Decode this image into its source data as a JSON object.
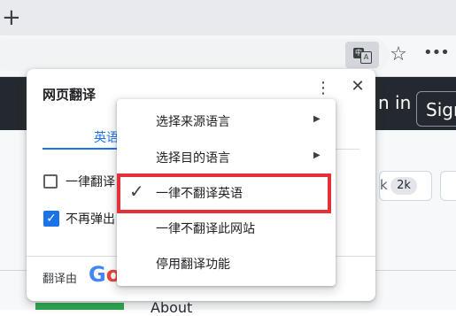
{
  "browser": {
    "new_tab_icon": "plus-icon",
    "translate_icon_glyph_a": "中",
    "translate_icon_glyph_b": "A",
    "favorite_icon": "star-icon",
    "more_icon": "more-horizontal-icon",
    "more_glyph": "•••"
  },
  "website": {
    "signin": "n in",
    "signup": "Sign",
    "badge_prefix": "k",
    "badge_count": "2k",
    "about": "About"
  },
  "translate_panel": {
    "title": "网页翻译",
    "more_glyph": "⋮",
    "close_glyph": "✕",
    "tab_label": "英语",
    "checkbox_always_label": "一律翻译",
    "checkbox_always_checked": false,
    "checkbox_no_popup_label": "不再弹出",
    "checkbox_no_popup_checked": true,
    "footer_prefix": "翻译由",
    "logo_letters": [
      "G",
      "o"
    ]
  },
  "context_menu": {
    "items": [
      {
        "label": "选择来源语言",
        "has_submenu": true
      },
      {
        "label": "选择目的语言",
        "has_submenu": true
      },
      {
        "label": "一律不翻译英语",
        "checked": true,
        "highlighted": true
      },
      {
        "label": "一律不翻译此网站"
      },
      {
        "label": "停用翻译功能"
      }
    ],
    "arrow_glyph": "▶",
    "check_glyph": "✓"
  },
  "colors": {
    "highlight_box": "#e5303a",
    "accent": "#1a73e8",
    "header_dark": "#24292f"
  }
}
